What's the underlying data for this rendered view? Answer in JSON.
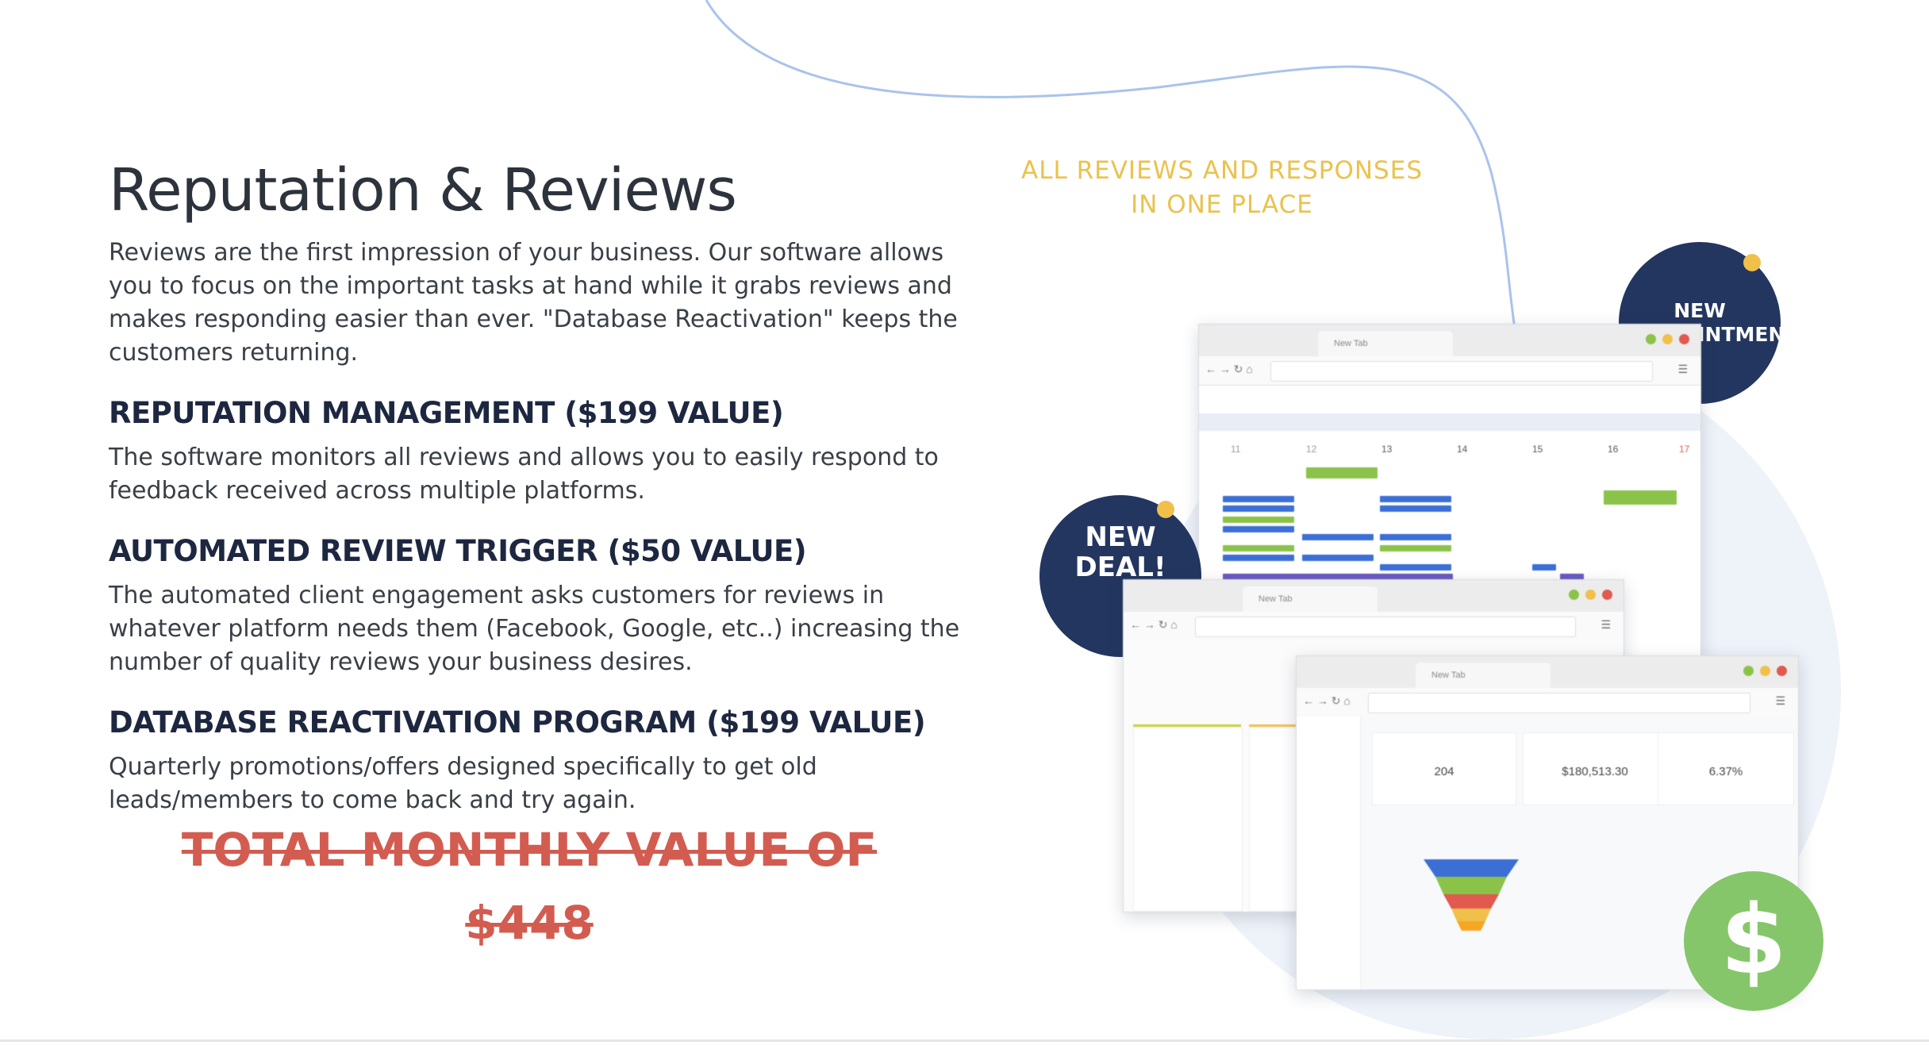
{
  "section": {
    "title": "Reputation & Reviews",
    "intro": "Reviews are the first impression of your business. Our software allows you to focus on the important tasks at hand while it grabs reviews and makes responding easier than ever. \"Database Reactivation\" keeps the customers returning."
  },
  "features": [
    {
      "heading": "REPUTATION MANAGEMENT ($199 VALUE)",
      "text": "The software monitors all reviews and allows you to easily respond to feedback received across multiple platforms."
    },
    {
      "heading": "AUTOMATED REVIEW TRIGGER ($50 VALUE)",
      "text": "The automated client engagement asks customers for reviews in whatever platform needs them (Facebook, Google, etc..) increasing the number of quality reviews your business desires."
    },
    {
      "heading": "DATABASE REACTIVATION PROGRAM ($199 VALUE)",
      "text": "Quarterly promotions/offers designed specifically to get old leads/members to come back and try again."
    }
  ],
  "total": {
    "line1": "TOTAL MONTHLY VALUE OF",
    "line2": "$448"
  },
  "illustration": {
    "tagline": "ALL REVIEWS AND RESPONSES IN ONE PLACE",
    "badge_appointment": "NEW APPOINTMENT!",
    "badge_deal": "NEW DEAL!",
    "tab_label": "New Tab",
    "calendar_days": [
      "11",
      "12",
      "13",
      "14",
      "15",
      "16",
      "17"
    ],
    "dashboard_stats": [
      "204",
      "$180,513.30",
      "6.37%"
    ],
    "dollar_icon": "$"
  },
  "colors": {
    "heading": "#2d333c",
    "subheading": "#1d2740",
    "strike_red": "#d35c51",
    "tagline_gold": "#eac24d",
    "badge_navy": "#23365f",
    "dollar_green": "#86c66a"
  }
}
